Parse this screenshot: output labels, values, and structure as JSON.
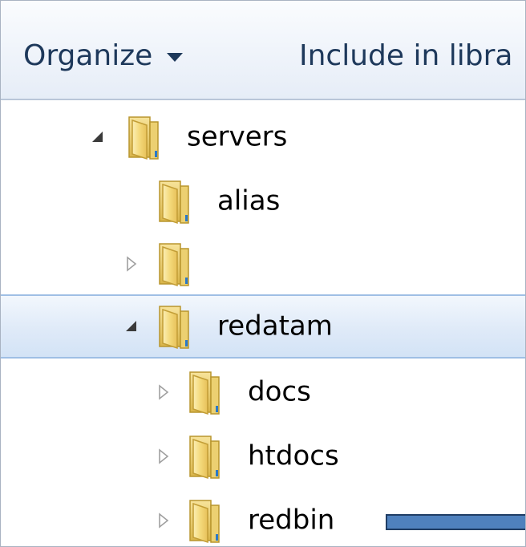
{
  "toolbar": {
    "organize_label": "Organize",
    "include_label": "Include in libra"
  },
  "tree": {
    "items": [
      {
        "label": "servers",
        "expander": "expanded-arrow-icon",
        "icon": "folder-icon"
      },
      {
        "label": "alias",
        "expander": "none",
        "icon": "folder-icon"
      },
      {
        "label": "",
        "expander": "collapsed-arrow-icon",
        "icon": "folder-icon"
      },
      {
        "label": "redatam",
        "expander": "expanded-arrow-icon",
        "icon": "folder-icon",
        "selected": true
      },
      {
        "label": "docs",
        "expander": "collapsed-arrow-icon",
        "icon": "folder-icon"
      },
      {
        "label": "htdocs",
        "expander": "collapsed-arrow-icon",
        "icon": "folder-icon"
      },
      {
        "label": "redbin",
        "expander": "collapsed-arrow-icon",
        "icon": "folder-icon"
      }
    ]
  },
  "colors": {
    "toolbar_text": "#1e395b",
    "selection_fill": "#dfeaf8",
    "selection_border": "#9fbfe5",
    "folder_yellow": "#f3d56e",
    "highlight_bar": "#4f81bd"
  }
}
